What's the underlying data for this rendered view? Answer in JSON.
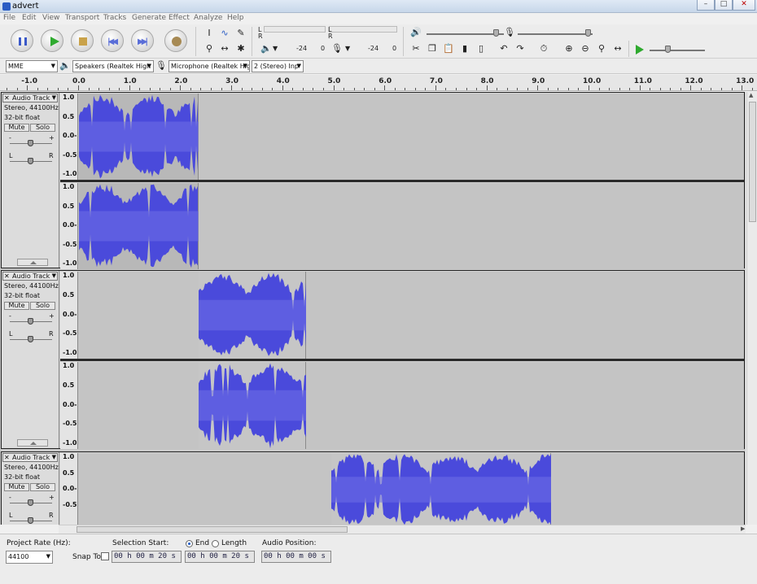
{
  "window": {
    "title": "advert",
    "controls": [
      "minimize",
      "maximize",
      "close"
    ]
  },
  "menu": [
    "File",
    "Edit",
    "View",
    "Transport",
    "Tracks",
    "Generate",
    "Effect",
    "Analyze",
    "Help"
  ],
  "meters": {
    "left_label": "L",
    "right_label": "R",
    "playback_db": "-24",
    "playback_zero": "0",
    "record_db": "-24",
    "record_zero": "0"
  },
  "devices": {
    "host": "MME",
    "output": "Speakers (Realtek High",
    "input": "Microphone (Realtek Hig",
    "channels": "2 (Stereo) Inp"
  },
  "ruler": {
    "ticks": [
      "-1.0",
      "0.0",
      "1.0",
      "2.0",
      "3.0",
      "4.0",
      "5.0",
      "6.0",
      "7.0",
      "8.0",
      "9.0",
      "10.0",
      "11.0",
      "12.0",
      "13.0"
    ]
  },
  "tracks": [
    {
      "name": "Audio Track",
      "format": "Stereo, 44100Hz",
      "bits": "32-bit float",
      "mute": "Mute",
      "solo": "Solo",
      "gain_minus": "-",
      "gain_plus": "+",
      "pan_left": "L",
      "pan_right": "R",
      "scale": [
        "1.0",
        "0.5",
        "0.0-",
        "-0.5",
        "-1.0"
      ],
      "clip_start_sec": 0.0,
      "clip_end_sec": 2.35
    },
    {
      "name": "Audio Track",
      "format": "Stereo, 44100Hz",
      "bits": "32-bit float",
      "mute": "Mute",
      "solo": "Solo",
      "gain_minus": "-",
      "gain_plus": "+",
      "pan_left": "L",
      "pan_right": "R",
      "scale": [
        "1.0",
        "0.5",
        "0.0-",
        "-0.5",
        "-1.0"
      ],
      "clip_start_sec": 2.35,
      "clip_end_sec": 4.45
    },
    {
      "name": "Audio Track",
      "format": "Stereo, 44100Hz",
      "bits": "32-bit float",
      "mute": "Mute",
      "solo": "Solo",
      "gain_minus": "-",
      "gain_plus": "+",
      "pan_left": "L",
      "pan_right": "R",
      "scale": [
        "1.0",
        "0.5",
        "0.0-",
        "-0.5"
      ],
      "clip_start_sec": 4.95,
      "clip_end_sec": 9.25
    }
  ],
  "status": {
    "project_rate_label": "Project Rate (Hz):",
    "project_rate": "44100",
    "snap_to": "Snap To",
    "selection_start_label": "Selection Start:",
    "end_label": "End",
    "length_label": "Length",
    "audio_position_label": "Audio Position:",
    "selection_start": "00 h 00 m 20 s",
    "selection_end": "00 h 00 m 20 s",
    "audio_position": "00 h 00 m 00 s"
  },
  "colors": {
    "waveform": "#4a4adb",
    "waveform_rms": "#6f6fe6",
    "selected_bg": "#b8b8b8",
    "track_bg": "#c4c4c4"
  }
}
